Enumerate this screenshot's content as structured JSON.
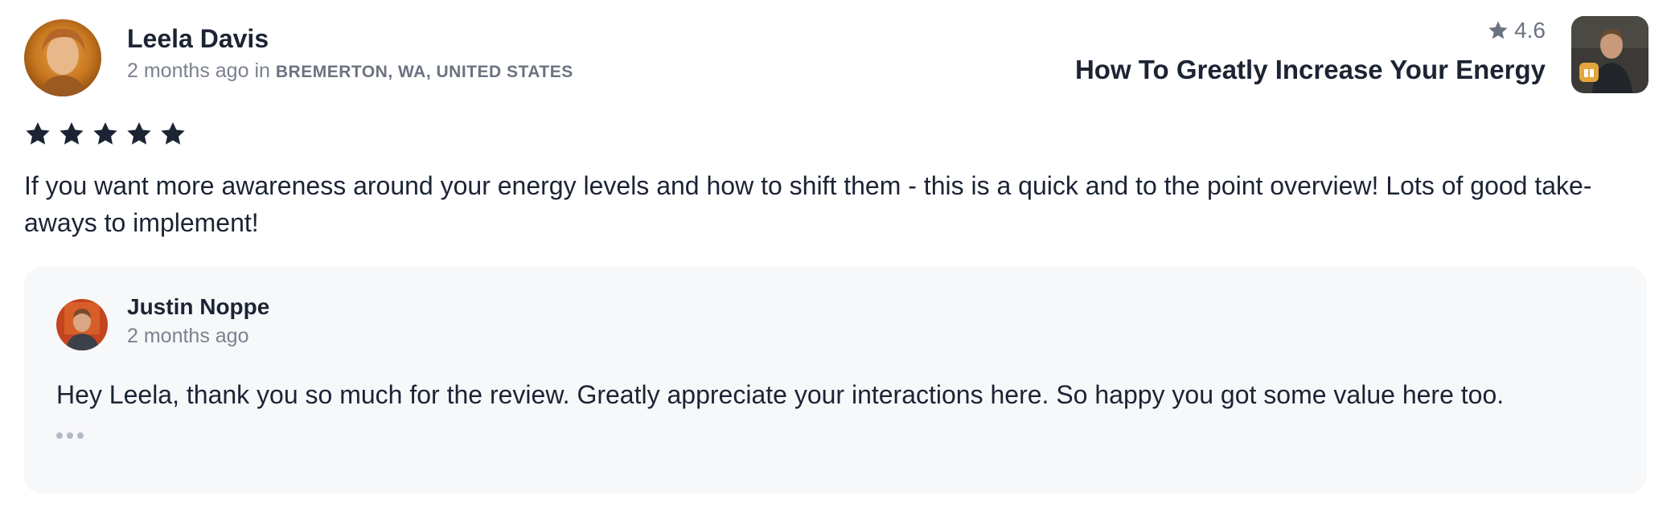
{
  "review": {
    "reviewer_name": "Leela Davis",
    "time_ago": "2 months ago",
    "location_prefix": "in",
    "location": "BREMERTON, WA, UNITED STATES",
    "rating_stars": 5,
    "text": "If you want more awareness around your energy levels and how to shift them - this is a quick and to the point overview! Lots of good take-aways to implement!"
  },
  "course": {
    "rating": "4.6",
    "title": "How To Greatly Increase Your Energy"
  },
  "reply": {
    "author_name": "Justin Noppe",
    "time_ago": "2 months ago",
    "text": "Hey Leela, thank you so much for the review. Greatly appreciate your interactions here. So happy you got some value here too."
  },
  "colors": {
    "text_primary": "#1c2434",
    "text_muted": "#7a828f",
    "reply_background": "#f7f8fa",
    "badge_accent": "#e3a63a"
  },
  "icons": {
    "rating_star": "star-icon",
    "more": "more-dots-icon",
    "badge": "gift-icon"
  }
}
